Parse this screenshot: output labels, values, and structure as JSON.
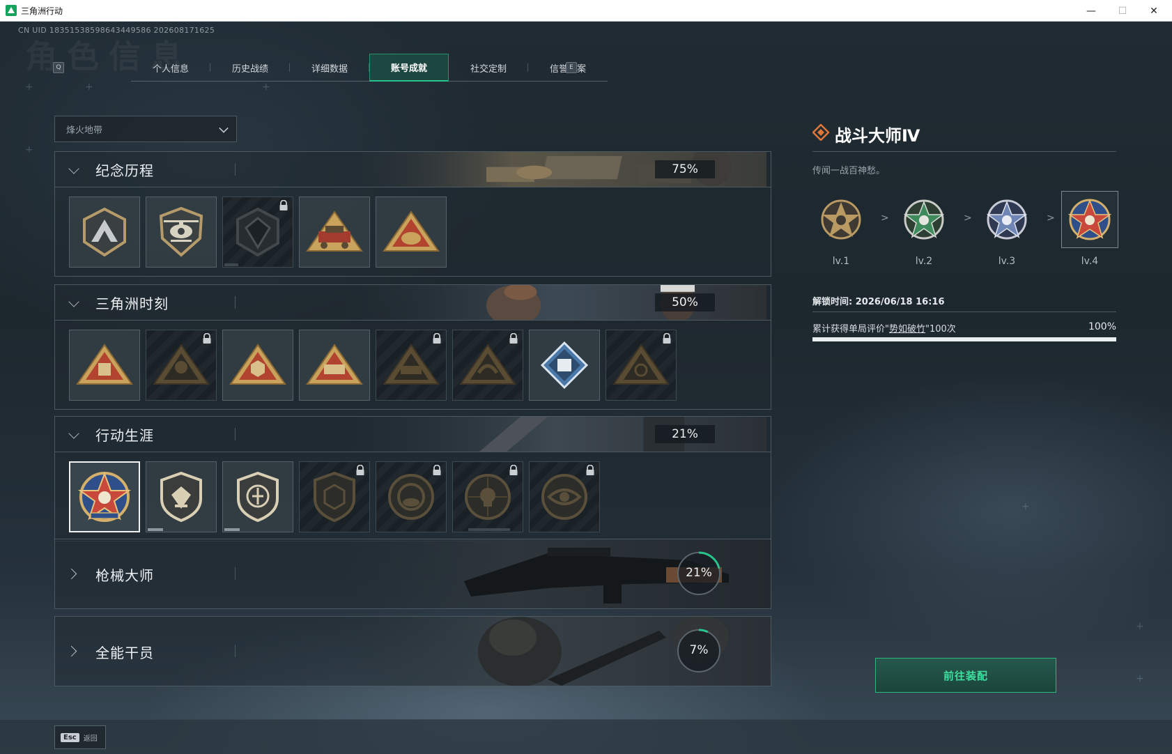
{
  "window": {
    "title": "三角洲行动",
    "minimize": "—",
    "maximize": "☐",
    "close": "✕"
  },
  "uid": "CN UID 18351538598643449586 202608171625",
  "tabs": {
    "left_key": "Q",
    "right_key": "E",
    "items": [
      {
        "label": "个人信息",
        "active": false
      },
      {
        "label": "历史战绩",
        "active": false
      },
      {
        "label": "详细数据",
        "active": false
      },
      {
        "label": "账号成就",
        "active": true
      },
      {
        "label": "社交定制",
        "active": false
      },
      {
        "label": "信誉档案",
        "active": false
      }
    ]
  },
  "mode_select": {
    "value": "烽火地带"
  },
  "sections": [
    {
      "title": "纪念历程",
      "dots": "001",
      "percent": "75%",
      "expanded": true,
      "badges": [
        {
          "icon": "mountain-shield-badge",
          "locked": false
        },
        {
          "icon": "helicopter-badge",
          "locked": false
        },
        {
          "icon": "hexagon-emblem-badge",
          "locked": true
        },
        {
          "icon": "vehicle-badge",
          "locked": false
        },
        {
          "icon": "egg-triangle-badge",
          "locked": false
        }
      ]
    },
    {
      "title": "三角洲时刻",
      "dots": "002",
      "percent": "50%",
      "expanded": true,
      "badges": [
        {
          "icon": "supply-crate-badge",
          "locked": false
        },
        {
          "icon": "operator-triangle-badge",
          "locked": true
        },
        {
          "icon": "hex-hands-badge",
          "locked": false
        },
        {
          "icon": "squad-triangle-badge",
          "locked": false
        },
        {
          "icon": "horse-triangle-badge",
          "locked": true
        },
        {
          "icon": "bird-triangle-badge",
          "locked": true
        },
        {
          "icon": "crate-diamond-badge",
          "locked": false
        },
        {
          "icon": "dragon-triangle-badge",
          "locked": true
        }
      ]
    },
    {
      "title": "行动生涯",
      "dots": "003",
      "percent": "21%",
      "expanded": true,
      "badges": [
        {
          "icon": "combat-master-star-badge",
          "locked": false,
          "selected": true
        },
        {
          "icon": "shield-wings-badge",
          "locked": false,
          "progress": 0.22
        },
        {
          "icon": "shield-arrows-badge",
          "locked": false,
          "progress": 0.22
        },
        {
          "icon": "hex-shield-badge",
          "locked": true
        },
        {
          "icon": "ring-orb-badge",
          "locked": true
        },
        {
          "icon": "skull-round-badge",
          "locked": true
        },
        {
          "icon": "eye-round-badge",
          "locked": true
        }
      ]
    },
    {
      "title": "枪械大师",
      "dots": "004",
      "percent": "21%",
      "ring_value": 0.21,
      "expanded": false
    },
    {
      "title": "全能干员",
      "dots": "005",
      "percent": "7%",
      "ring_value": 0.07,
      "expanded": false
    }
  ],
  "detail": {
    "title": "战斗大师Ⅳ",
    "description": "传闻一战百神愁。",
    "levels": [
      {
        "label": "lv.1",
        "color": "#b89a62"
      },
      {
        "label": "lv.2",
        "color": "#3f8a5c"
      },
      {
        "label": "lv.3",
        "color": "#6f86b5"
      },
      {
        "label": "lv.4",
        "color": "#c8493b",
        "current": true
      }
    ],
    "arrow": ">",
    "unlock_time": "解锁时间: 2026/06/18 16:16",
    "requirement_prefix": "累计获得单局评价\"",
    "requirement_highlight": "势如破竹",
    "requirement_suffix": "\"100次",
    "requirement_percent": "100%",
    "requirement_progress": 1.0,
    "equip_button": "前往装配"
  },
  "footer": {
    "esc_key": "Esc",
    "esc_label": "返回"
  },
  "colors": {
    "accent": "#27c58d",
    "badge_gold": "#c9a35c",
    "ring": "#27c58d"
  }
}
